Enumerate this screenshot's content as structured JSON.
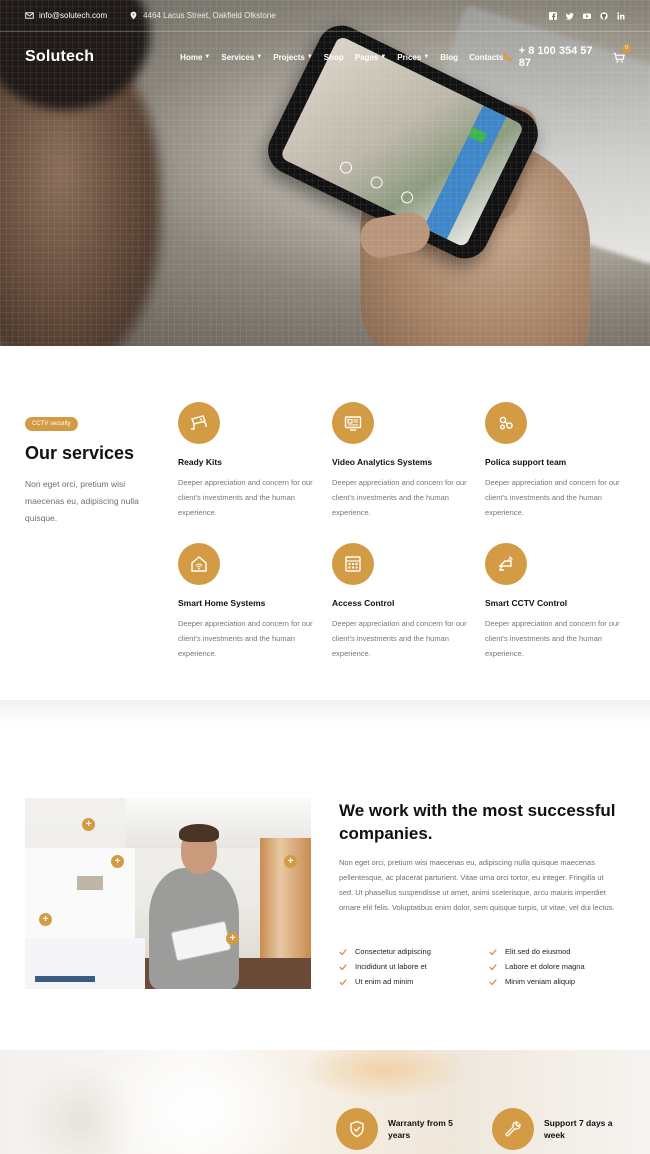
{
  "topbar": {
    "email": "info@solutech.com",
    "address": "4464 Lacus Street, Oakfield Olkstone",
    "socials": [
      "facebook-icon",
      "twitter-icon",
      "youtube-icon",
      "github-icon",
      "linkedin-icon"
    ]
  },
  "nav": {
    "logo": "Solutech",
    "items": [
      {
        "label": "Home",
        "dropdown": true
      },
      {
        "label": "Services",
        "dropdown": true
      },
      {
        "label": "Projects",
        "dropdown": true
      },
      {
        "label": "Shop",
        "dropdown": false
      },
      {
        "label": "Pages",
        "dropdown": true
      },
      {
        "label": "Prices",
        "dropdown": true
      },
      {
        "label": "Blog",
        "dropdown": false
      },
      {
        "label": "Contacts",
        "dropdown": false
      }
    ],
    "phone": "+ 8 100 354 57 87",
    "cart_count": "0"
  },
  "services": {
    "tag": "CCTV security",
    "title": "Our services",
    "description": "Non eget orci, pretium wisi maecenas eu, adipiscing nulla quisque.",
    "cards": [
      {
        "icon": "cctv-camera-icon",
        "title": "Ready Kits",
        "text": "Deeper appreciation and concern for our client's investments and the human experience."
      },
      {
        "icon": "video-analytics-icon",
        "title": "Video Analytics Systems",
        "text": "Deeper appreciation and concern for our client's investments and the human experience."
      },
      {
        "icon": "support-team-icon",
        "title": "Polica support team",
        "text": "Deeper appreciation and concern for our client's investments and the human experience."
      },
      {
        "icon": "smart-home-icon",
        "title": "Smart Home Systems",
        "text": "Deeper appreciation and concern for our client's investments and the human experience."
      },
      {
        "icon": "access-control-icon",
        "title": "Access Control",
        "text": "Deeper appreciation and concern for our client's investments and the human experience."
      },
      {
        "icon": "smart-cctv-icon",
        "title": "Smart CCTV Control",
        "text": "Deeper appreciation and concern for our client's investments and the human experience."
      }
    ]
  },
  "about": {
    "title": "We work with the most successful companies.",
    "text": "Non eget orci, pretium wisi maecenas eu, adipiscing nulla quisque maecenas pellentesque, ac placerat parturient. Vitae urna orci tortor, eu integer. Fringilla ut sed. Ut phasellus suspendisse ut amet, animi scelerisque, arcu mauris imperdiet ornare elit felis. Voluptatibus enim dolor, sem quisque turpis, ut vitae, vel dui lectus.",
    "checks": [
      "Consectetur adipiscing",
      "Elit sed do eiusmod",
      "Incididunt ut labore et",
      "Labore et dolore magna",
      "Ut enim ad minim",
      "Minim veniam aliquip"
    ]
  },
  "features": [
    {
      "icon": "shield-check-icon",
      "label": "Warranty from 5 years"
    },
    {
      "icon": "wrench-icon",
      "label": "Support 7 days a week"
    }
  ],
  "colors": {
    "accent": "#d49b45",
    "text": "#111111",
    "muted": "#6f6f6f"
  }
}
